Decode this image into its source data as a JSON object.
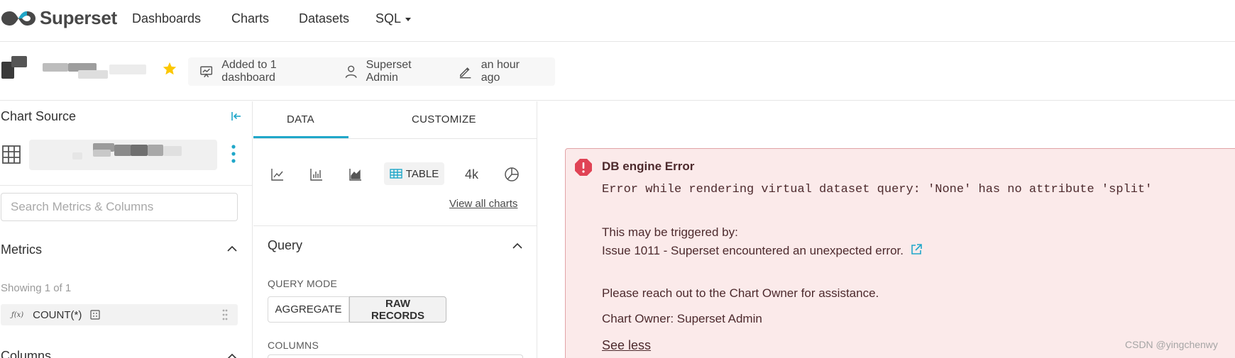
{
  "nav": {
    "brand": "Superset",
    "items": [
      "Dashboards",
      "Charts",
      "Datasets",
      "SQL"
    ]
  },
  "header": {
    "added_to": "Added to 1 dashboard",
    "owner": "Superset Admin",
    "modified": "an hour ago"
  },
  "left": {
    "chart_source": "Chart Source",
    "search_placeholder": "Search Metrics & Columns",
    "metrics_title": "Metrics",
    "showing": "Showing 1 of 1",
    "metric": "COUNT(*)",
    "fx": "ƒ(x)",
    "columns_title": "Columns"
  },
  "mid": {
    "tabs": [
      "DATA",
      "CUSTOMIZE"
    ],
    "table_label": "TABLE",
    "big_number_label": "4k",
    "view_all": "View all charts",
    "query_title": "Query",
    "query_mode_label": "QUERY MODE",
    "modes": [
      "AGGREGATE",
      "RAW RECORDS"
    ],
    "columns_label": "COLUMNS"
  },
  "error": {
    "title": "DB engine Error",
    "message": "Error while rendering virtual dataset query: 'None' has no attribute 'split'",
    "triggered_by": "This may be triggered by:",
    "issue": "Issue 1011 - Superset encountered an unexpected error.",
    "reach_out": "Please reach out to the Chart Owner for assistance.",
    "chart_owner": "Chart Owner: Superset Admin",
    "see_less": "See less"
  },
  "watermark": "CSDN @yingchenwy",
  "colors": {
    "accent": "#20a7c9",
    "star": "#fcc700",
    "error_bg": "#fbeaea",
    "error_border": "#e1a3a6",
    "error_icon": "#e04355"
  }
}
